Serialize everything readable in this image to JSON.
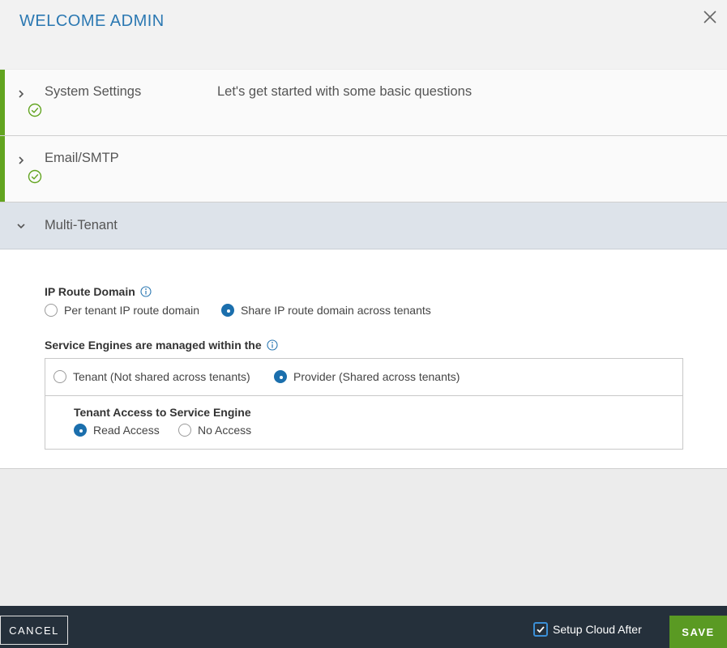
{
  "header": {
    "title": "WELCOME ADMIN",
    "close_icon": "close-icon"
  },
  "steps": [
    {
      "label": "System Settings",
      "description": "Let's get started with some basic questions",
      "status": "done"
    },
    {
      "label": "Email/SMTP",
      "status": "done"
    },
    {
      "label": "Multi-Tenant",
      "status": "expanded"
    }
  ],
  "ip_route": {
    "label": "IP Route Domain",
    "options": [
      "Per tenant IP route domain",
      "Share IP route domain across tenants"
    ],
    "selected": "Share IP route domain across tenants"
  },
  "service_engines": {
    "label": "Service Engines are managed within the",
    "options": [
      "Tenant (Not shared across tenants)",
      "Provider (Shared across tenants)"
    ],
    "selected": "Provider (Shared across tenants)",
    "tenant_access": {
      "label": "Tenant Access to Service Engine",
      "options": [
        "Read Access",
        "No Access"
      ],
      "selected": "Read Access"
    }
  },
  "footer": {
    "cancel_label": "CANCEL",
    "setup_cloud_label": "Setup Cloud After",
    "setup_cloud_checked": true,
    "save_label": "SAVE"
  },
  "colors": {
    "accent": "#1b6fad",
    "title": "#2b78b2",
    "success": "#62a420",
    "save": "#5a9a23",
    "footer_bg": "#25303b"
  }
}
